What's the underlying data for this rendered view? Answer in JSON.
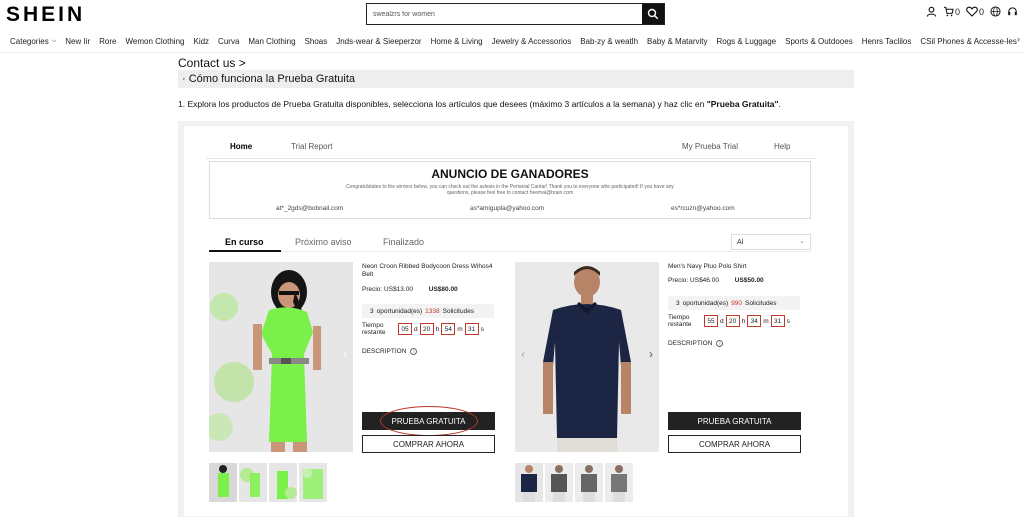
{
  "header": {
    "logo": "SHEIN",
    "search_value": "swealzrs for women",
    "cart_count": "0",
    "wishlist_count": "0"
  },
  "nav": {
    "items": [
      "Categories",
      "New Iir",
      "Rore",
      "Wemon Clothing",
      "Kidz",
      "Curva",
      "Man Clothing",
      "Shoas",
      "Jnds-wear & Sieeperzor",
      "Home & Living",
      "Jewelry & Accessorios",
      "Bab-zy & weatlh",
      "Baby & Matarvity",
      "Rogs & Luggage",
      "Sports & Outdooes",
      "Henrs Taclilos",
      "CSil Phones & Accesse-les"
    ]
  },
  "content": {
    "contact": "Contact us >",
    "section_title": "· Cómo funciona la Prueba Gratuita",
    "step1_text": "1. Explora los productos de Prueba Gratuita disponibles, selecciona los artículos que desees (máximo 3 artículos a la semana) y haz clic en ",
    "step1_bold": "\"Prueba Gratuita\"",
    "step1_end": "."
  },
  "trial": {
    "tabs": {
      "home": "Home",
      "report": "Trial Report",
      "my": "My Prueba Trial",
      "help": "Help"
    },
    "announcement": {
      "title": "ANUNCIO DE GANADORES",
      "text1": "Congratulstates to the wirners below, you can check out the aslesis in the Pertanial Cantar! Thank you to everyone whe participated! If you have any",
      "text2": "questions, please feel free to contact heemai@brain.com",
      "winners": [
        "at*_2gds@bobnail.com",
        "as*amigupla@yahoo.com",
        "es*rcuzn@yahoo.com"
      ]
    },
    "status_tabs": {
      "active": "En curso",
      "next": "Próximo aviso",
      "done": "Finalizado"
    },
    "select_value": "Al",
    "products": [
      {
        "name": "Neon Croon Ribbed Bodycoon Dress Wihos4 Belt",
        "price_label": "Precio: US$13.00",
        "price_value": "US$80.00",
        "opp_count": "3",
        "opp_label": "oportunidad(es)",
        "requests": "1338",
        "requests_label": "Solicitudes",
        "time_label_1": "Tiempo",
        "time_label_2": "restante",
        "days": "05",
        "hours": "20",
        "minutes": "54",
        "seconds": "31",
        "unit_d": "d",
        "unit_h": "h",
        "unit_m": "m",
        "unit_s": "s",
        "description": "DESCRIPTION",
        "trial_button": "PRUEBA GRATUITA",
        "buy_button": "COMPRAR AHORA"
      },
      {
        "name": "Men's Navy Pluo Polo Shirt",
        "price_label": "Precio: US$46.00",
        "price_value": "US$50.00",
        "opp_count": "3",
        "opp_label": "oportunidad(es)",
        "requests": "990",
        "requests_label": "Solicitudes",
        "time_label_1": "Tiempo",
        "time_label_2": "restante",
        "days": "55",
        "hours": "20",
        "minutes": "34",
        "seconds": "31",
        "unit_d": "d",
        "unit_h": "h",
        "unit_m": "m",
        "unit_s": "s",
        "description": "DESCRIPTION",
        "trial_button": "PRUEBA GRATUITA",
        "buy_button": "COMPRAR AHORA"
      }
    ]
  },
  "colors": {
    "accent_red": "#c0392b",
    "dress_green": "#7cf04a",
    "polo_navy": "#1d2545"
  }
}
